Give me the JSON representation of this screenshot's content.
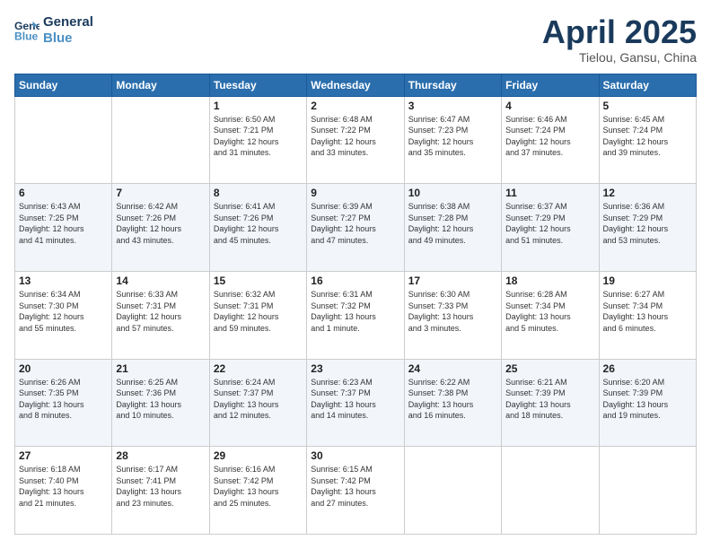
{
  "logo": {
    "line1": "General",
    "line2": "Blue"
  },
  "title": "April 2025",
  "subtitle": "Tielou, Gansu, China",
  "days_header": [
    "Sunday",
    "Monday",
    "Tuesday",
    "Wednesday",
    "Thursday",
    "Friday",
    "Saturday"
  ],
  "weeks": [
    [
      {
        "num": "",
        "info": ""
      },
      {
        "num": "",
        "info": ""
      },
      {
        "num": "1",
        "info": "Sunrise: 6:50 AM\nSunset: 7:21 PM\nDaylight: 12 hours\nand 31 minutes."
      },
      {
        "num": "2",
        "info": "Sunrise: 6:48 AM\nSunset: 7:22 PM\nDaylight: 12 hours\nand 33 minutes."
      },
      {
        "num": "3",
        "info": "Sunrise: 6:47 AM\nSunset: 7:23 PM\nDaylight: 12 hours\nand 35 minutes."
      },
      {
        "num": "4",
        "info": "Sunrise: 6:46 AM\nSunset: 7:24 PM\nDaylight: 12 hours\nand 37 minutes."
      },
      {
        "num": "5",
        "info": "Sunrise: 6:45 AM\nSunset: 7:24 PM\nDaylight: 12 hours\nand 39 minutes."
      }
    ],
    [
      {
        "num": "6",
        "info": "Sunrise: 6:43 AM\nSunset: 7:25 PM\nDaylight: 12 hours\nand 41 minutes."
      },
      {
        "num": "7",
        "info": "Sunrise: 6:42 AM\nSunset: 7:26 PM\nDaylight: 12 hours\nand 43 minutes."
      },
      {
        "num": "8",
        "info": "Sunrise: 6:41 AM\nSunset: 7:26 PM\nDaylight: 12 hours\nand 45 minutes."
      },
      {
        "num": "9",
        "info": "Sunrise: 6:39 AM\nSunset: 7:27 PM\nDaylight: 12 hours\nand 47 minutes."
      },
      {
        "num": "10",
        "info": "Sunrise: 6:38 AM\nSunset: 7:28 PM\nDaylight: 12 hours\nand 49 minutes."
      },
      {
        "num": "11",
        "info": "Sunrise: 6:37 AM\nSunset: 7:29 PM\nDaylight: 12 hours\nand 51 minutes."
      },
      {
        "num": "12",
        "info": "Sunrise: 6:36 AM\nSunset: 7:29 PM\nDaylight: 12 hours\nand 53 minutes."
      }
    ],
    [
      {
        "num": "13",
        "info": "Sunrise: 6:34 AM\nSunset: 7:30 PM\nDaylight: 12 hours\nand 55 minutes."
      },
      {
        "num": "14",
        "info": "Sunrise: 6:33 AM\nSunset: 7:31 PM\nDaylight: 12 hours\nand 57 minutes."
      },
      {
        "num": "15",
        "info": "Sunrise: 6:32 AM\nSunset: 7:31 PM\nDaylight: 12 hours\nand 59 minutes."
      },
      {
        "num": "16",
        "info": "Sunrise: 6:31 AM\nSunset: 7:32 PM\nDaylight: 13 hours\nand 1 minute."
      },
      {
        "num": "17",
        "info": "Sunrise: 6:30 AM\nSunset: 7:33 PM\nDaylight: 13 hours\nand 3 minutes."
      },
      {
        "num": "18",
        "info": "Sunrise: 6:28 AM\nSunset: 7:34 PM\nDaylight: 13 hours\nand 5 minutes."
      },
      {
        "num": "19",
        "info": "Sunrise: 6:27 AM\nSunset: 7:34 PM\nDaylight: 13 hours\nand 6 minutes."
      }
    ],
    [
      {
        "num": "20",
        "info": "Sunrise: 6:26 AM\nSunset: 7:35 PM\nDaylight: 13 hours\nand 8 minutes."
      },
      {
        "num": "21",
        "info": "Sunrise: 6:25 AM\nSunset: 7:36 PM\nDaylight: 13 hours\nand 10 minutes."
      },
      {
        "num": "22",
        "info": "Sunrise: 6:24 AM\nSunset: 7:37 PM\nDaylight: 13 hours\nand 12 minutes."
      },
      {
        "num": "23",
        "info": "Sunrise: 6:23 AM\nSunset: 7:37 PM\nDaylight: 13 hours\nand 14 minutes."
      },
      {
        "num": "24",
        "info": "Sunrise: 6:22 AM\nSunset: 7:38 PM\nDaylight: 13 hours\nand 16 minutes."
      },
      {
        "num": "25",
        "info": "Sunrise: 6:21 AM\nSunset: 7:39 PM\nDaylight: 13 hours\nand 18 minutes."
      },
      {
        "num": "26",
        "info": "Sunrise: 6:20 AM\nSunset: 7:39 PM\nDaylight: 13 hours\nand 19 minutes."
      }
    ],
    [
      {
        "num": "27",
        "info": "Sunrise: 6:18 AM\nSunset: 7:40 PM\nDaylight: 13 hours\nand 21 minutes."
      },
      {
        "num": "28",
        "info": "Sunrise: 6:17 AM\nSunset: 7:41 PM\nDaylight: 13 hours\nand 23 minutes."
      },
      {
        "num": "29",
        "info": "Sunrise: 6:16 AM\nSunset: 7:42 PM\nDaylight: 13 hours\nand 25 minutes."
      },
      {
        "num": "30",
        "info": "Sunrise: 6:15 AM\nSunset: 7:42 PM\nDaylight: 13 hours\nand 27 minutes."
      },
      {
        "num": "",
        "info": ""
      },
      {
        "num": "",
        "info": ""
      },
      {
        "num": "",
        "info": ""
      }
    ]
  ]
}
